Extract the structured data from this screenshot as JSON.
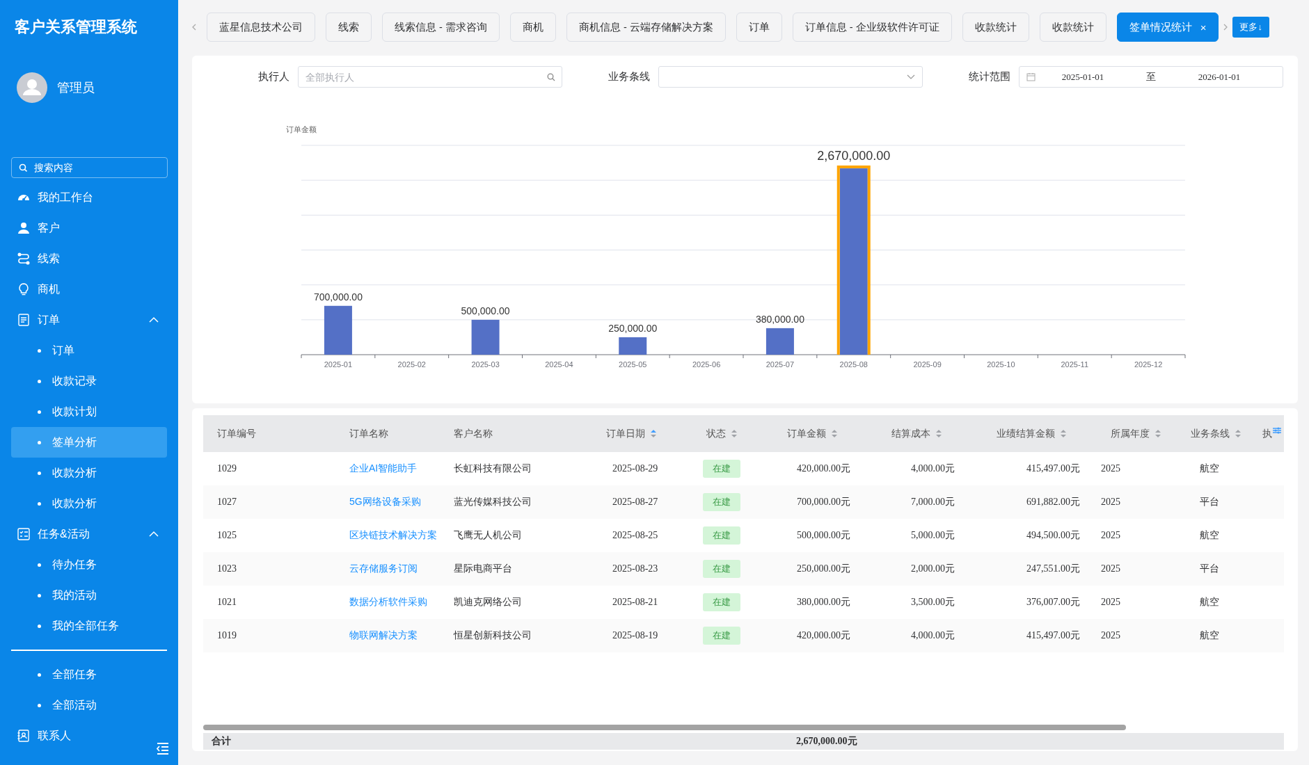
{
  "sidebar": {
    "title": "客户关系管理系统",
    "user": {
      "name": "管理员"
    },
    "search": {
      "placeholder": "搜索内容"
    },
    "menu": [
      {
        "label": "我的工作台",
        "kind": "dashboard",
        "selected": false
      },
      {
        "label": "客户",
        "kind": "person",
        "selected": false
      },
      {
        "label": "线索",
        "kind": "route",
        "selected": false
      },
      {
        "label": "商机",
        "kind": "bulb",
        "selected": false
      },
      {
        "label": "订单",
        "kind": "document",
        "selected": false,
        "expanded": true,
        "children": [
          {
            "label": "订单",
            "selected": false
          },
          {
            "label": "收款记录",
            "selected": false
          },
          {
            "label": "收款计划",
            "selected": false
          },
          {
            "label": "签单分析",
            "selected": true
          },
          {
            "label": "收款分析",
            "selected": false
          },
          {
            "label": "收款分析",
            "selected": false
          }
        ]
      },
      {
        "label": "任务&活动",
        "kind": "checklist",
        "selected": false,
        "expanded": true,
        "children": [
          {
            "label": "待办任务",
            "selected": false
          },
          {
            "label": "我的活动",
            "selected": false
          },
          {
            "label": "我的全部任务",
            "selected": false
          },
          {
            "label": "全部任务",
            "selected": false,
            "divider_before": true
          },
          {
            "label": "全部活动",
            "selected": false
          }
        ]
      },
      {
        "label": "联系人",
        "kind": "contact",
        "selected": false
      }
    ]
  },
  "tabs": [
    {
      "label": "蓝星信息技术公司",
      "selected": false
    },
    {
      "label": "线索",
      "selected": false
    },
    {
      "label": "线索信息 - 需求咨询",
      "selected": false
    },
    {
      "label": "商机",
      "selected": false
    },
    {
      "label": "商机信息 - 云端存储解决方案",
      "selected": false
    },
    {
      "label": "订单",
      "selected": false
    },
    {
      "label": "订单信息 - 企业级软件许可证",
      "selected": false
    },
    {
      "label": "收款统计",
      "selected": false
    },
    {
      "label": "收款统计",
      "selected": false
    },
    {
      "label": "签单情况统计",
      "selected": true,
      "close": "×"
    }
  ],
  "more_button": "更多↓",
  "filters": {
    "executor": {
      "label": "执行人",
      "placeholder": "全部执行人"
    },
    "business_line": {
      "label": "业务条线"
    },
    "date_range": {
      "label": "统计范围",
      "start": "2025-01-01",
      "separator": "至",
      "end": "2026-01-01"
    }
  },
  "chart": {
    "chart_data": {
      "type": "bar",
      "ylabel": "订单金额",
      "categories": [
        "2025-01",
        "2025-02",
        "2025-03",
        "2025-04",
        "2025-05",
        "2025-06",
        "2025-07",
        "2025-08",
        "2025-09",
        "2025-10",
        "2025-11",
        "2025-12"
      ],
      "values": [
        700000,
        null,
        500000,
        null,
        250000,
        null,
        380000,
        2670000,
        null,
        null,
        null,
        null
      ],
      "value_labels": [
        "700,000.00",
        null,
        "500,000.00",
        null,
        "250,000.00",
        null,
        "380,000.00",
        "2,670,000.00",
        null,
        null,
        null,
        null
      ]
    },
    "bars": [
      {
        "selected": false
      },
      {
        "selected": false
      },
      {
        "selected": false
      },
      {
        "selected": false
      },
      {
        "selected": false
      },
      {
        "selected": false
      },
      {
        "selected": false
      },
      {
        "selected": true
      },
      {
        "selected": false
      },
      {
        "selected": false
      },
      {
        "selected": false
      },
      {
        "selected": false
      }
    ]
  },
  "table": {
    "columns": [
      {
        "label": "订单编号"
      },
      {
        "label": "订单名称"
      },
      {
        "label": "客户名称"
      },
      {
        "label": "订单日期",
        "sortable": true,
        "sorted_ascending": true
      },
      {
        "label": "状态",
        "sortable": true,
        "sorted_ascending": false
      },
      {
        "label": "订单金额",
        "sortable": true,
        "sorted_ascending": false
      },
      {
        "label": "结算成本",
        "sortable": true,
        "sorted_ascending": false
      },
      {
        "label": "业绩结算金额",
        "sortable": true,
        "sorted_ascending": false
      },
      {
        "label": "所属年度",
        "sortable": true,
        "sorted_ascending": false
      },
      {
        "label": "业务条线",
        "sortable": true,
        "sorted_ascending": false
      },
      {
        "label": "执"
      }
    ],
    "rows": [
      [
        "1029",
        "企业AI智能助手",
        "长虹科技有限公司",
        "2025-08-29",
        "在建",
        "420,000.00元",
        "4,000.00元",
        "415,497.00元",
        "2025",
        "航空"
      ],
      [
        "1027",
        "5G网络设备采购",
        "蓝光传媒科技公司",
        "2025-08-27",
        "在建",
        "700,000.00元",
        "7,000.00元",
        "691,882.00元",
        "2025",
        "平台"
      ],
      [
        "1025",
        "区块链技术解决方案",
        "飞鹰无人机公司",
        "2025-08-25",
        "在建",
        "500,000.00元",
        "5,000.00元",
        "494,500.00元",
        "2025",
        "航空"
      ],
      [
        "1023",
        "云存储服务订阅",
        "星际电商平台",
        "2025-08-23",
        "在建",
        "250,000.00元",
        "2,000.00元",
        "247,551.00元",
        "2025",
        "平台"
      ],
      [
        "1021",
        "数据分析软件采购",
        "凯迪克网络公司",
        "2025-08-21",
        "在建",
        "380,000.00元",
        "3,500.00元",
        "376,007.00元",
        "2025",
        "航空"
      ],
      [
        "1019",
        "物联网解决方案",
        "恒星创新科技公司",
        "2025-08-19",
        "在建",
        "420,000.00元",
        "4,000.00元",
        "415,497.00元",
        "2025",
        "航空"
      ]
    ],
    "footer": {
      "label": "合计",
      "amount": "2,670,000.00元"
    }
  }
}
